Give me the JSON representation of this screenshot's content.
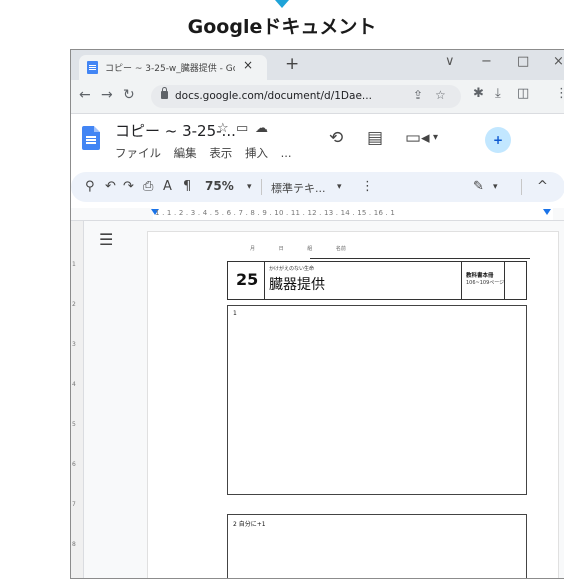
{
  "caption": "Googleドキュメント",
  "browser": {
    "tab_title": "コピー ~ 3-25-w_臓器提供 - Goo",
    "tab_close": "×",
    "new_tab": "+",
    "tab_search": "∨",
    "minimize": "−",
    "maximize": "□",
    "close": "×",
    "url": "docs.google.com/document/d/1Dae..."
  },
  "docs": {
    "title": "コピー ~ 3-25-...",
    "menus": [
      "ファイル",
      "編集",
      "表示",
      "挿入",
      "..."
    ],
    "share_label": "+"
  },
  "toolbar": {
    "zoom": "75%",
    "style": "標準テキ..."
  },
  "ruler": {
    "numbers": "1 . 1 . 2 . 3 . 4 . 5 . 6 . 7 . 8 . 9 . 10 . 11 . 12 . 13 . 14 . 15 . 16 . 1"
  },
  "document": {
    "date_labels": [
      "月",
      "日",
      "組",
      "名前"
    ],
    "lesson_number": "25",
    "lesson_subtitle": "かけがえのない生命",
    "lesson_title": "臓器提供",
    "ref_line1": "教科書本冊",
    "ref_line2": "106~109ページ",
    "box1_label": "1",
    "box2_label": "2 自分に+1"
  }
}
